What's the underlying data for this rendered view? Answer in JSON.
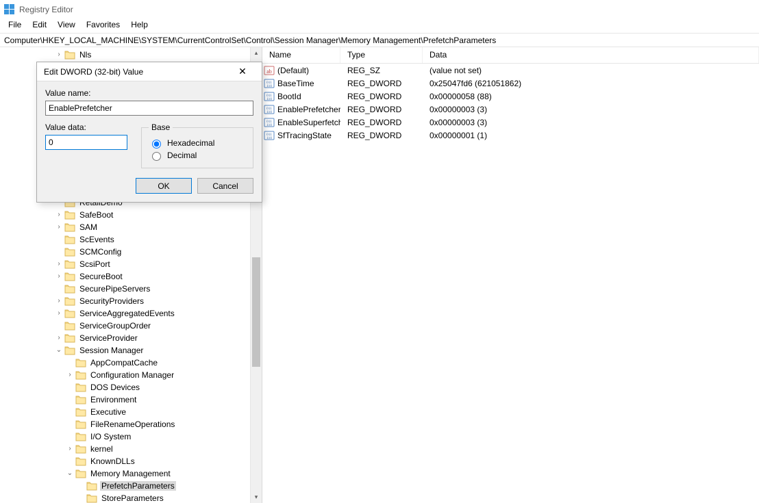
{
  "app": {
    "title": "Registry Editor"
  },
  "menu": {
    "file": "File",
    "edit": "Edit",
    "view": "View",
    "favorites": "Favorites",
    "help": "Help"
  },
  "address": "Computer\\HKEY_LOCAL_MACHINE\\SYSTEM\\CurrentControlSet\\Control\\Session Manager\\Memory Management\\PrefetchParameters",
  "tree": {
    "items": [
      {
        "indent": 5,
        "exp": "right",
        "label": "Nls",
        "selected": false
      },
      {
        "indent": 5,
        "exp": "",
        "label": "RetailDemo"
      },
      {
        "indent": 5,
        "exp": "right",
        "label": "SafeBoot"
      },
      {
        "indent": 5,
        "exp": "right",
        "label": "SAM"
      },
      {
        "indent": 5,
        "exp": "",
        "label": "ScEvents"
      },
      {
        "indent": 5,
        "exp": "",
        "label": "SCMConfig"
      },
      {
        "indent": 5,
        "exp": "right",
        "label": "ScsiPort"
      },
      {
        "indent": 5,
        "exp": "right",
        "label": "SecureBoot"
      },
      {
        "indent": 5,
        "exp": "",
        "label": "SecurePipeServers"
      },
      {
        "indent": 5,
        "exp": "right",
        "label": "SecurityProviders"
      },
      {
        "indent": 5,
        "exp": "right",
        "label": "ServiceAggregatedEvents"
      },
      {
        "indent": 5,
        "exp": "",
        "label": "ServiceGroupOrder"
      },
      {
        "indent": 5,
        "exp": "right",
        "label": "ServiceProvider"
      },
      {
        "indent": 5,
        "exp": "down",
        "label": "Session Manager"
      },
      {
        "indent": 6,
        "exp": "",
        "label": "AppCompatCache"
      },
      {
        "indent": 6,
        "exp": "right",
        "label": "Configuration Manager"
      },
      {
        "indent": 6,
        "exp": "",
        "label": "DOS Devices"
      },
      {
        "indent": 6,
        "exp": "",
        "label": "Environment"
      },
      {
        "indent": 6,
        "exp": "",
        "label": "Executive"
      },
      {
        "indent": 6,
        "exp": "",
        "label": "FileRenameOperations"
      },
      {
        "indent": 6,
        "exp": "",
        "label": "I/O System"
      },
      {
        "indent": 6,
        "exp": "right",
        "label": "kernel"
      },
      {
        "indent": 6,
        "exp": "",
        "label": "KnownDLLs"
      },
      {
        "indent": 6,
        "exp": "down",
        "label": "Memory Management"
      },
      {
        "indent": 7,
        "exp": "",
        "label": "PrefetchParameters",
        "selected": true
      },
      {
        "indent": 7,
        "exp": "",
        "label": "StoreParameters"
      }
    ]
  },
  "list": {
    "columns": {
      "name": "Name",
      "type": "Type",
      "data": "Data"
    },
    "rows": [
      {
        "icon": "string",
        "name": "(Default)",
        "type": "REG_SZ",
        "data": "(value not set)"
      },
      {
        "icon": "binary",
        "name": "BaseTime",
        "type": "REG_DWORD",
        "data": "0x25047fd6 (621051862)"
      },
      {
        "icon": "binary",
        "name": "BootId",
        "type": "REG_DWORD",
        "data": "0x00000058 (88)"
      },
      {
        "icon": "binary",
        "name": "EnablePrefetcher",
        "type": "REG_DWORD",
        "data": "0x00000003 (3)"
      },
      {
        "icon": "binary",
        "name": "EnableSuperfetch",
        "type": "REG_DWORD",
        "data": "0x00000003 (3)"
      },
      {
        "icon": "binary",
        "name": "SfTracingState",
        "type": "REG_DWORD",
        "data": "0x00000001 (1)"
      }
    ]
  },
  "dialog": {
    "title": "Edit DWORD (32-bit) Value",
    "value_name_label": "Value name:",
    "value_name": "EnablePrefetcher",
    "value_data_label": "Value data:",
    "value_data": "0",
    "base_label": "Base",
    "hex_label": "Hexadecimal",
    "dec_label": "Decimal",
    "base_selected": "hex",
    "ok": "OK",
    "cancel": "Cancel"
  }
}
